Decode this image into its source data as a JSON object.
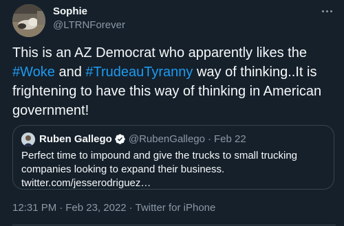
{
  "tweet": {
    "author": {
      "display_name": "Sophie",
      "handle": "@LTRNForever"
    },
    "text_before": "This is an AZ Democrat who apparently likes the ",
    "hashtag_1": "#Woke",
    "text_middle": " and ",
    "hashtag_2": "#TrudeauTyranny",
    "text_after": " way of thinking..It is frightening to have this way of thinking in American government!",
    "time": "12:31 PM",
    "separator": "·",
    "date": "Feb 23, 2022",
    "source": "Twitter for iPhone"
  },
  "quoted_tweet": {
    "author_name": "Ruben Gallego",
    "author_handle": "@RubenGallego",
    "separator": "·",
    "date": "Feb 22",
    "text": "Perfect time to impound and give the trucks to small trucking companies looking to expand their business.",
    "link": "twitter.com/jesserodriguez…"
  },
  "icons": {
    "more": "more-horizontal-icon",
    "verified": "verified-badge-icon"
  },
  "colors": {
    "background": "#15202b",
    "primary_text": "#f7f9f9",
    "secondary_text": "#8b98a5",
    "link": "#1d9bf0",
    "border": "#38444d"
  }
}
